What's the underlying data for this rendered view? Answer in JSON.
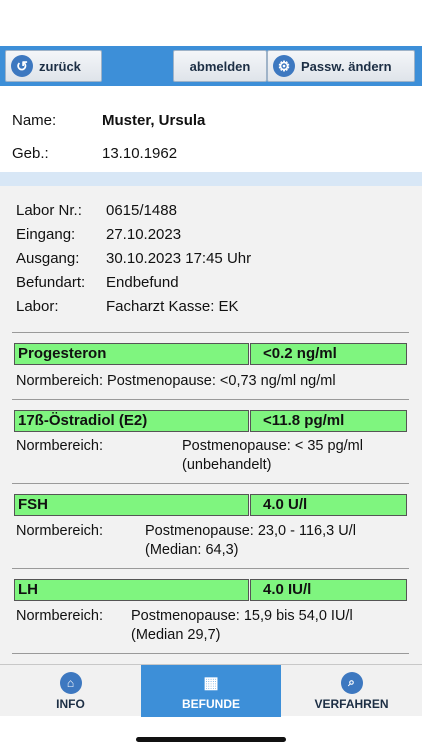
{
  "toolbar": {
    "back_label": "zurück",
    "logout_label": "abmelden",
    "password_label": "Passw. ändern"
  },
  "patient": {
    "name_label": "Name:",
    "name_value": "Muster, Ursula",
    "dob_label": "Geb.:",
    "dob_value": "13.10.1962"
  },
  "lab_meta": [
    {
      "label": "Labor Nr.:",
      "value": "0615/1488"
    },
    {
      "label": "Eingang:",
      "value": "27.10.2023"
    },
    {
      "label": "Ausgang:",
      "value": "30.10.2023 17:45 Uhr"
    },
    {
      "label": "Befundart:",
      "value": "Endbefund"
    },
    {
      "label": "Labor:",
      "value": "Facharzt Kasse: EK"
    }
  ],
  "results": [
    {
      "name": "Progesteron",
      "value": "<0.2 ng/ml",
      "range_line1": "Normbereich: Postmenopause: <0,73 ng/ml ng/ml"
    },
    {
      "name": "17ß-Östradiol (E2)",
      "value": "<11.8 pg/ml",
      "range_label": "Normbereich:",
      "range_text": "Postmenopause: < 35 pg/ml",
      "range_text2": "(unbehandelt)"
    },
    {
      "name": "FSH",
      "value": "4.0 U/l",
      "range_label": "Normbereich:",
      "range_text": "Postmenopause: 23,0 - 116,3 U/l",
      "range_text2": "(Median: 64,3)"
    },
    {
      "name": "LH",
      "value": "4.0 IU/l",
      "range_label": "Normbereich:",
      "range_text": "Postmenopause: 15,9 bis 54,0 IU/l",
      "range_text2": "(Median 29,7)"
    }
  ],
  "tabs": {
    "info": "INFO",
    "befunde": "BEFUNDE",
    "verfahren": "VERFAHREN"
  },
  "colors": {
    "accent": "#3d8fd8",
    "result_bar": "#7ff57f"
  }
}
